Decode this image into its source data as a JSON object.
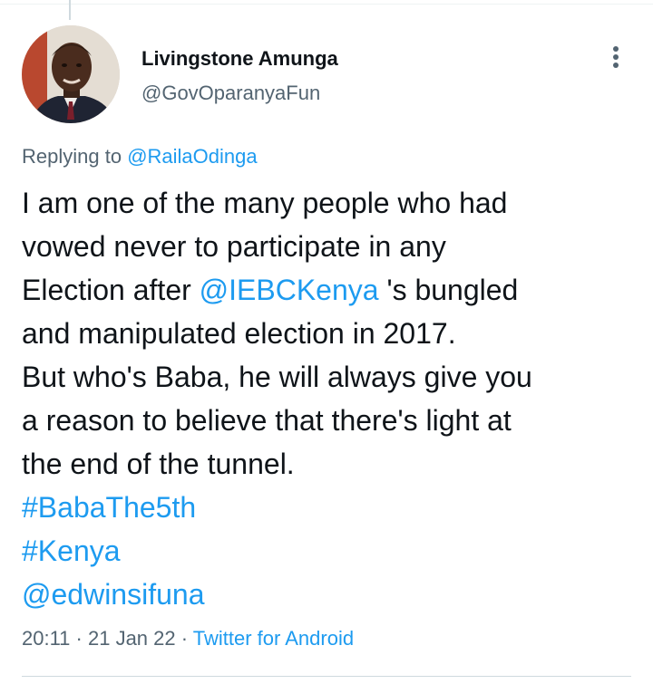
{
  "author": {
    "display_name": "Livingstone Amunga",
    "handle": "@GovOparanyaFun"
  },
  "reply": {
    "prefix": "Replying to",
    "mention": "@RailaOdinga"
  },
  "tweet": {
    "line1": "I am one of the many people who had",
    "line2": "vowed never to participate in any",
    "line3_before": "Election after ",
    "line3_mention": "@IEBCKenya",
    "line3_after": " 's bungled",
    "line4": "and manipulated election in 2017.",
    "line5": "But who's Baba, he will always give you",
    "line6": "a reason to believe that there's light at",
    "line7": "the end of the tunnel.",
    "hashtag1": "#BabaThe5th",
    "hashtag2": "#Kenya",
    "mention2": "@edwinsifuna"
  },
  "meta": {
    "time": "20:11",
    "separator": " · ",
    "date": "21 Jan 22",
    "source": "Twitter for Android"
  },
  "icons": {
    "more": "more-vertical-icon"
  },
  "colors": {
    "link": "#1d9bf0",
    "secondary_text": "#536471",
    "primary_text": "#0f1419"
  }
}
